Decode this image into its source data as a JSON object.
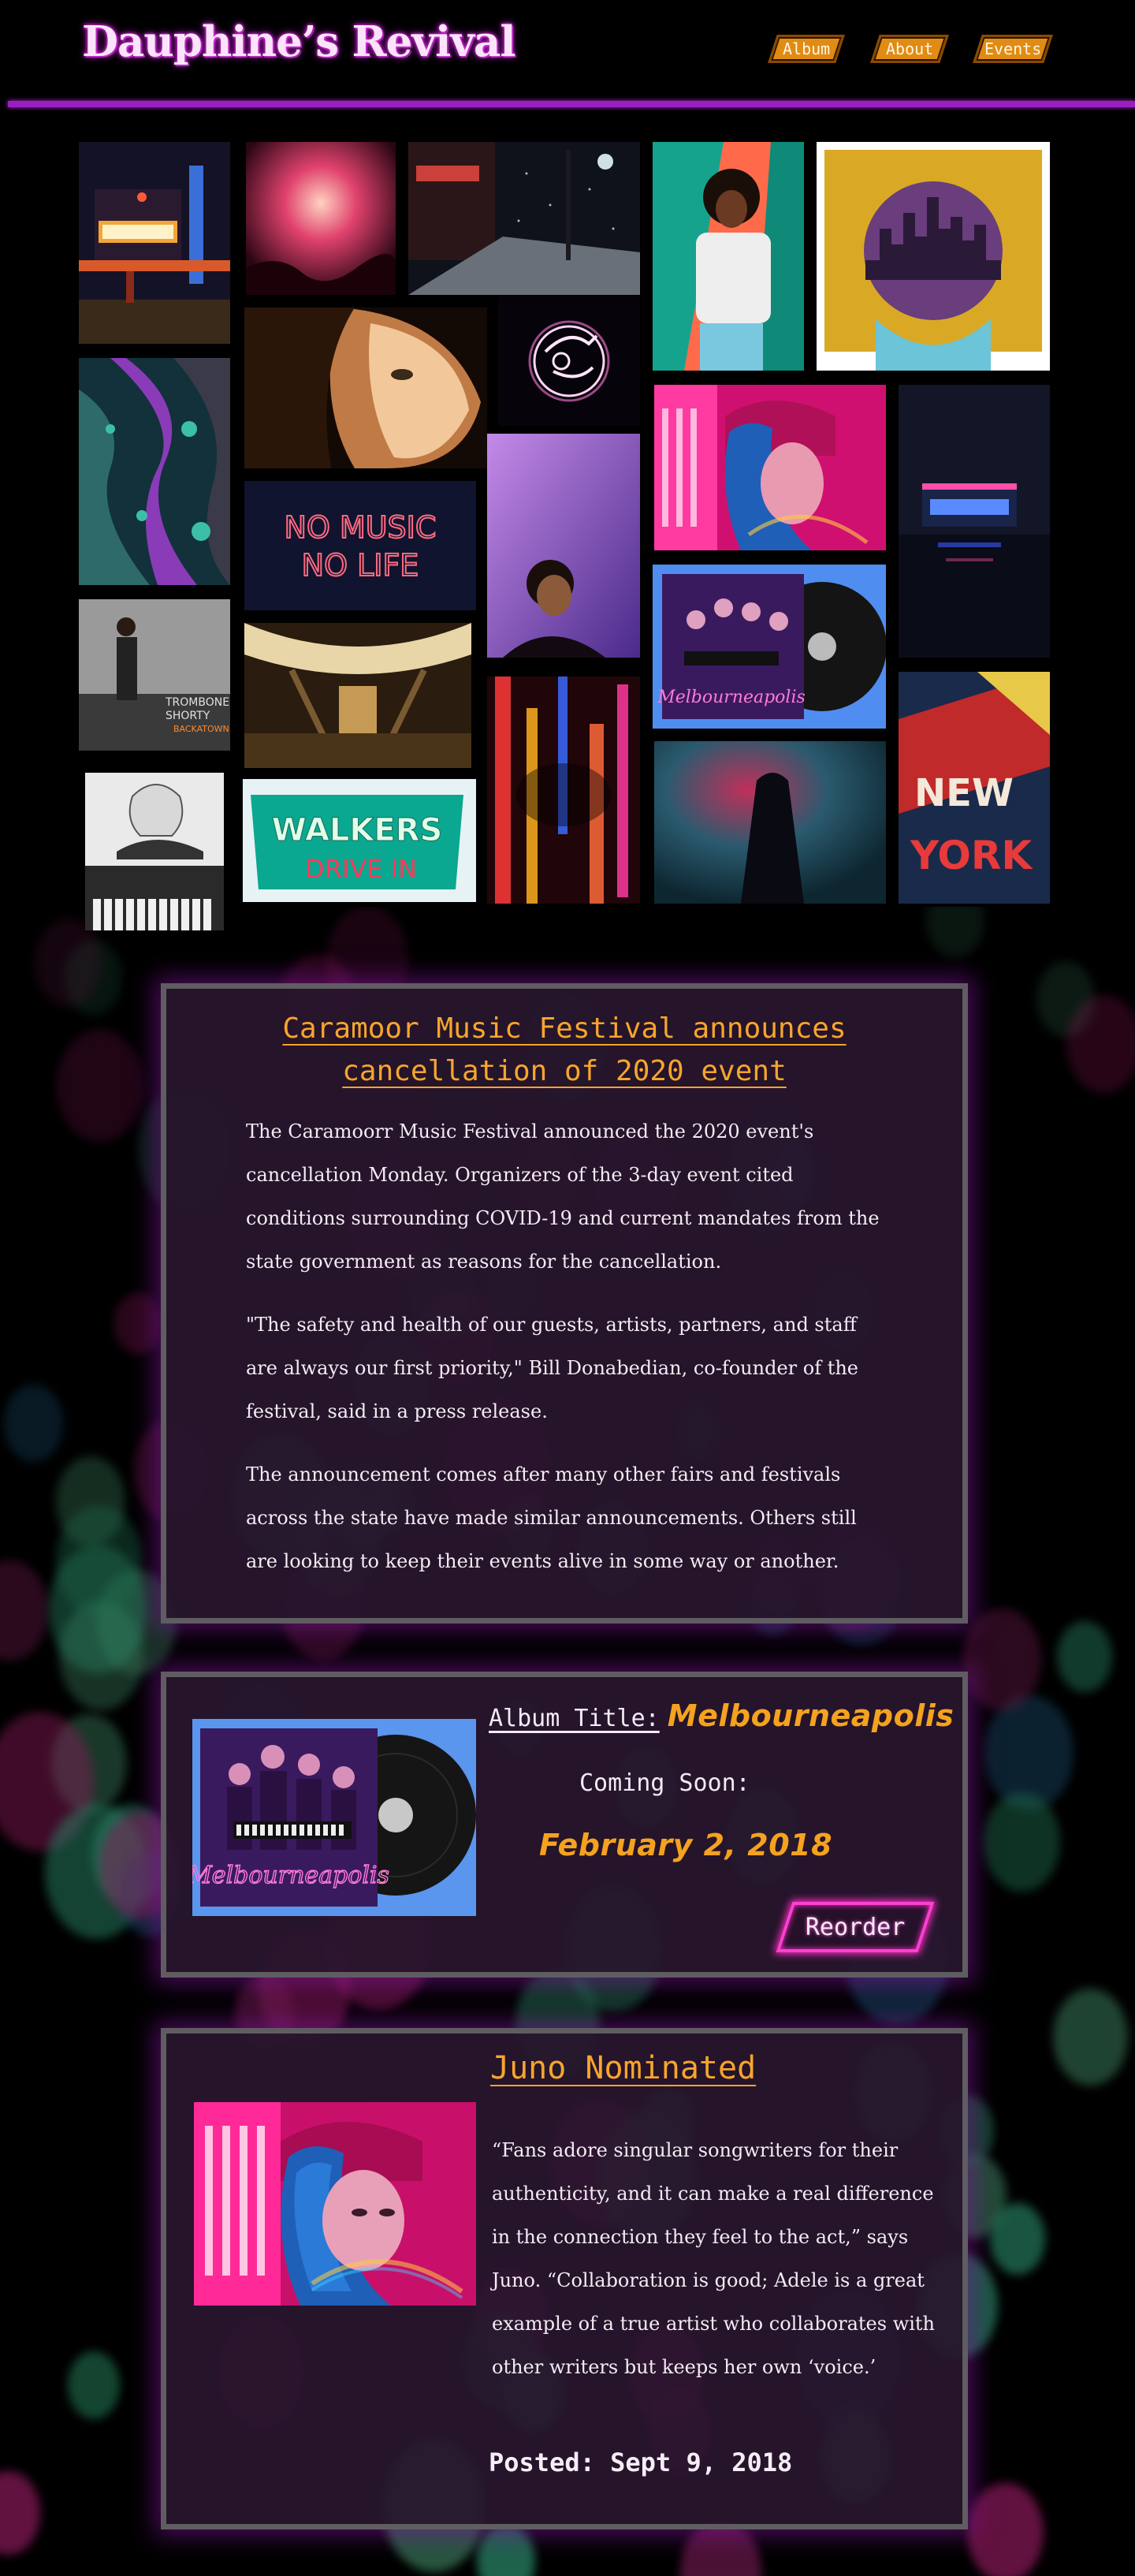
{
  "header": {
    "title": "Dauphine’s Revival",
    "nav": [
      {
        "label": "Album"
      },
      {
        "label": "About"
      },
      {
        "label": "Events"
      }
    ]
  },
  "gallery": {
    "images": [
      {
        "name": "theater-marquee-photo",
        "colors": [
          "#1c1a2a",
          "#f2a638",
          "#3b6fd8"
        ]
      },
      {
        "name": "concert-crowd-photo",
        "colors": [
          "#3a0a1c",
          "#e0426d",
          "#fcb1a8"
        ]
      },
      {
        "name": "snowy-street-photo",
        "colors": [
          "#0d1018",
          "#5c6270",
          "#c9413a"
        ]
      },
      {
        "name": "curly-hair-man-photo",
        "colors": [
          "#16a38d",
          "#ff6b4a",
          "#e8e8e8"
        ]
      },
      {
        "name": "city-album-art",
        "colors": [
          "#d9a926",
          "#6a3d7d",
          "#f0c94b"
        ]
      },
      {
        "name": "fluid-art-photo",
        "colors": [
          "#12313a",
          "#8a3bb8",
          "#3bbfa8"
        ]
      },
      {
        "name": "woman-face-photo",
        "colors": [
          "#1a0f08",
          "#c07a45",
          "#f2c89a"
        ]
      },
      {
        "name": "neon-trumpet-sign",
        "colors": [
          "#0a0408",
          "#ffd6f4",
          "#ff7ad8"
        ]
      },
      {
        "name": "blue-hair-woman-photo",
        "colors": [
          "#ff1e8c",
          "#1f5fb8",
          "#ff6ab0"
        ]
      },
      {
        "name": "night-diner-photo",
        "colors": [
          "#101425",
          "#3a5aff",
          "#ff4fa8"
        ]
      },
      {
        "name": "no-music-no-life-neon",
        "colors": [
          "#0f1230",
          "#ff2d55",
          "#ff8899"
        ]
      },
      {
        "name": "man-looking-up-photo",
        "colors": [
          "#6a3fb8",
          "#3a1f1a",
          "#c48ae8"
        ]
      },
      {
        "name": "melbourneapolis-album-tile",
        "colors": [
          "#4f8ef0",
          "#3a1a5e",
          "#111111"
        ]
      },
      {
        "name": "trombone-shorty-album",
        "colors": [
          "#2a2a2a",
          "#bdbdbd",
          "#ff8a2a"
        ]
      },
      {
        "name": "library-hall-photo",
        "colors": [
          "#2a1c0e",
          "#c49a55",
          "#7a5a32"
        ]
      },
      {
        "name": "city-lights-blur-photo",
        "colors": [
          "#2a0a10",
          "#ff3a3a",
          "#ffb020"
        ]
      },
      {
        "name": "hooded-figure-photo",
        "colors": [
          "#0e2630",
          "#c0305a",
          "#2a5a6e"
        ]
      },
      {
        "name": "new-york-art",
        "colors": [
          "#c02a2a",
          "#1a2a4a",
          "#e8c848"
        ]
      },
      {
        "name": "pianist-photo",
        "colors": [
          "#e0e0e0",
          "#3a3a3a",
          "#8a8a8a"
        ]
      },
      {
        "name": "walkers-drive-in-sign",
        "colors": [
          "#0aa890",
          "#ff3a5a",
          "#e0f0f0"
        ]
      }
    ],
    "neon_text": {
      "no_music": "NO MUSIC",
      "no_life": "NO LIFE",
      "walkers": "WALKERS",
      "drive_in": "DRIVE IN",
      "new": "NEW",
      "york": "YORK",
      "trombone": "TROMBONE",
      "shorty": "SHORTY",
      "backatown": "BACKATOWN"
    }
  },
  "news": {
    "title": "Caramoor Music Festival announces cancellation of 2020 event",
    "paragraphs": [
      "The Caramoorr Music Festival announced the 2020 event's cancellation Monday. Organizers of the 3-day event cited conditions surrounding COVID-19 and current mandates from the state government as reasons for the cancellation.",
      "\"The safety and health of our guests, artists, partners, and staff are always our first priority,\" Bill Donabedian, co-founder of the festival, said in a press release.",
      "The announcement comes after many other fairs and festivals across the state have made similar announcements. Others still are looking to keep their events alive in some way or another."
    ]
  },
  "album": {
    "title_label": "Album Title:",
    "title": "Melbourneapolis",
    "coming_soon": "Coming Soon:",
    "date": "February 2, 2018",
    "reorder_label": "Reorder",
    "cover_script": "Melbourneapolis"
  },
  "juno": {
    "title": "Juno Nominated",
    "quote": "“Fans adore singular songwriters for their authenticity, and it can make a real difference in the connection they feel to the act,” says Juno. “Collaboration is good; Adele is a great example of a true artist who collaborates with other writers but keeps her own ‘voice.’",
    "posted": "Posted: Sept 9, 2018"
  },
  "theme": {
    "accent_orange": "#f4a21f",
    "neon_pink": "#ff3fd0",
    "header_rule": "#9b1fc0"
  }
}
